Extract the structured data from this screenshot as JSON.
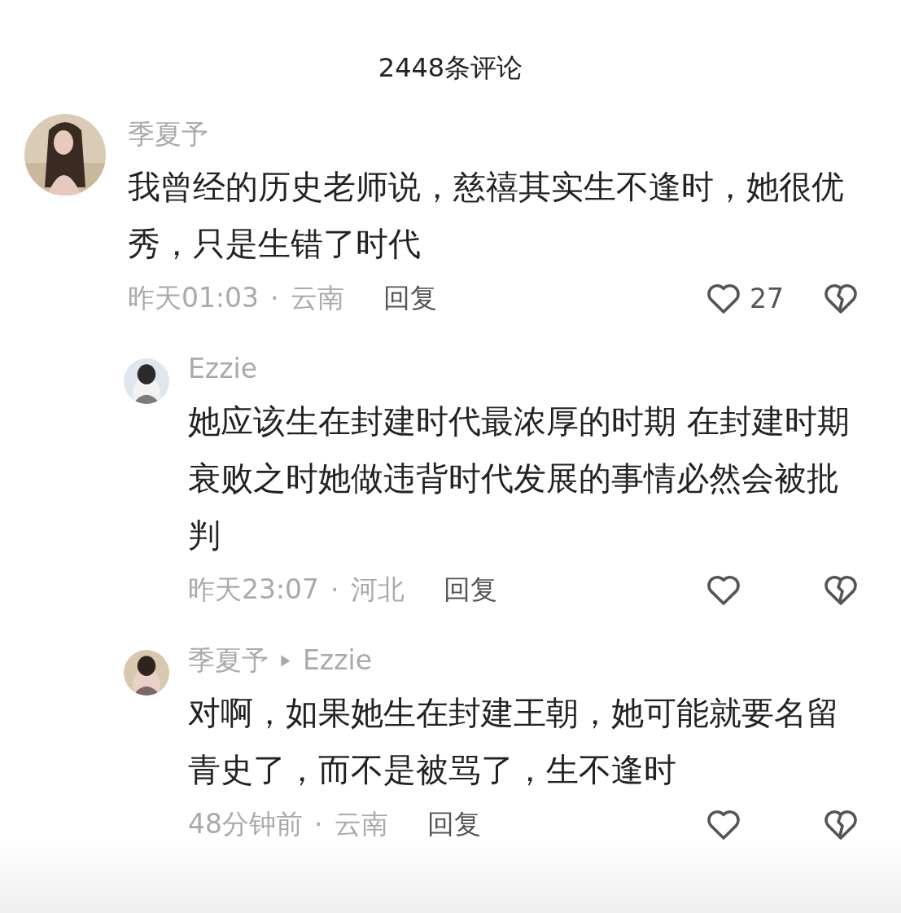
{
  "title": "2448条评论",
  "comments": [
    {
      "author": "季夏予",
      "text": "我曾经的历史老师说，慈禧其实生不逢时，她很优秀，只是生错了时代",
      "time": "昨天01:03",
      "separator": "·",
      "location": "云南",
      "reply_label": "回复",
      "likes": "27",
      "replies": [
        {
          "author": "Ezzie",
          "text": "她应该生在封建时代最浓厚的时期 在封建时期衰败之时她做违背时代发展的事情必然会被批判",
          "time": "昨天23:07",
          "separator": "·",
          "location": "河北",
          "reply_label": "回复"
        },
        {
          "author": "季夏予",
          "reply_to": "Ezzie",
          "text": "对啊，如果她生在封建王朝，她可能就要名留青史了，而不是被骂了，生不逢时",
          "time": "48分钟前",
          "separator": "·",
          "location": "云南",
          "reply_label": "回复"
        }
      ]
    }
  ]
}
